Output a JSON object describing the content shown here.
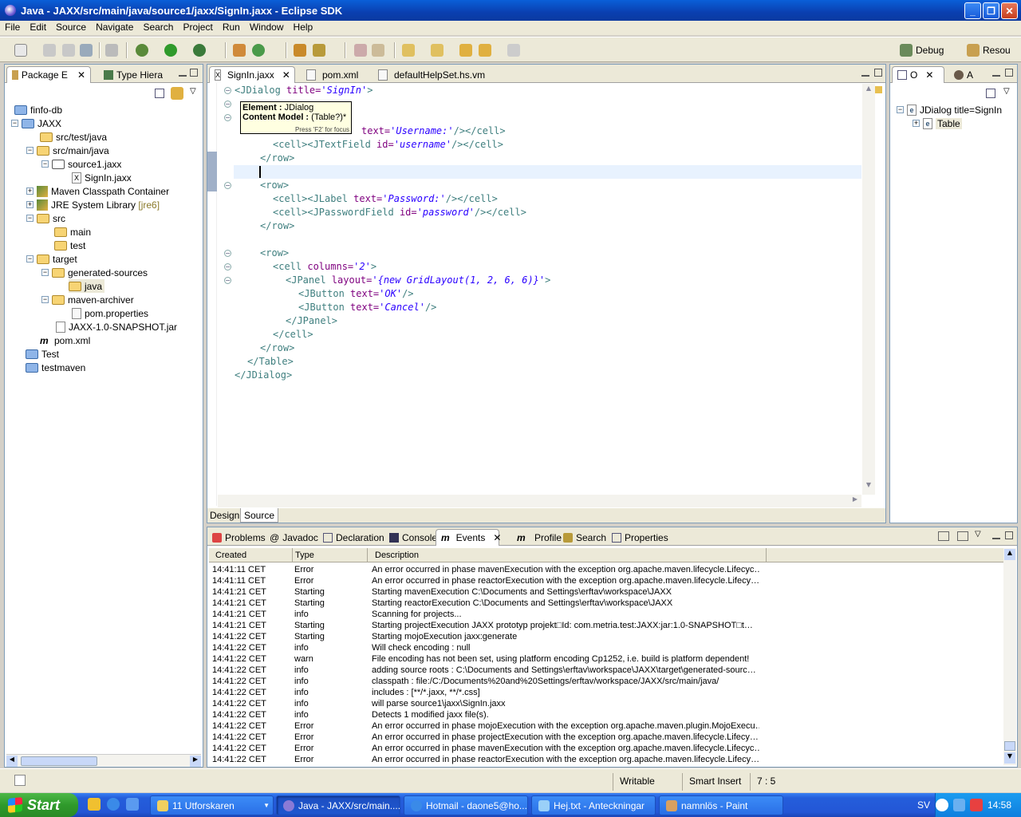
{
  "window": {
    "title": "Java - JAXX/src/main/java/source1/jaxx/SignIn.jaxx - Eclipse SDK"
  },
  "menu": [
    "File",
    "Edit",
    "Source",
    "Navigate",
    "Search",
    "Project",
    "Run",
    "Window",
    "Help"
  ],
  "perspectives": {
    "debug": "Debug",
    "resource": "Resou"
  },
  "left_view": {
    "tabs": [
      "Package E",
      "Type Hiera"
    ],
    "tree": [
      {
        "label": "finfo-db",
        "kind": "project"
      },
      {
        "label": "JAXX",
        "kind": "project"
      },
      {
        "label": "src/test/java",
        "kind": "srcfolder"
      },
      {
        "label": "src/main/java",
        "kind": "srcfolder"
      },
      {
        "label": "source1.jaxx",
        "kind": "package"
      },
      {
        "label": "SignIn.jaxx",
        "kind": "file"
      },
      {
        "label": "Maven Classpath Container",
        "kind": "lib"
      },
      {
        "label": "JRE System Library",
        "kind": "lib",
        "suffix": "[jre6]"
      },
      {
        "label": "src",
        "kind": "folder"
      },
      {
        "label": "main",
        "kind": "folder"
      },
      {
        "label": "test",
        "kind": "folder"
      },
      {
        "label": "target",
        "kind": "folder"
      },
      {
        "label": "generated-sources",
        "kind": "folder"
      },
      {
        "label": "java",
        "kind": "folder"
      },
      {
        "label": "maven-archiver",
        "kind": "folder"
      },
      {
        "label": "pom.properties",
        "kind": "file"
      },
      {
        "label": "JAXX-1.0-SNAPSHOT.jar",
        "kind": "jar"
      },
      {
        "label": "pom.xml",
        "kind": "maven"
      },
      {
        "label": "Test",
        "kind": "project"
      },
      {
        "label": "testmaven",
        "kind": "project"
      }
    ]
  },
  "editor": {
    "tabs": [
      "SignIn.jaxx",
      "pom.xml",
      "defaultHelpSet.hs.vm"
    ],
    "bottom_tabs": [
      "Design",
      "Source"
    ],
    "tooltip": {
      "element_label": "Element :",
      "element_value": "JDialog",
      "model_label": "Content Model :",
      "model_value": "(Table?)*",
      "hint": "Press 'F2' for focus"
    },
    "lines": [
      {
        "t": "<JDialog ",
        "a": "title=",
        "v": "'SignIn'",
        "e": ">"
      },
      {
        "t": "",
        "a": "",
        "v": "",
        "e": ""
      },
      {
        "t": "",
        "a": "",
        "v": "",
        "e": ""
      },
      {
        "t": "",
        "a": "text=",
        "v": "'Username:'",
        "e": "/></cell>"
      },
      {
        "t": "<cell><JTextField ",
        "a": "id=",
        "v": "'username'",
        "e": "/></cell>"
      },
      {
        "t": "</row>",
        "a": "",
        "v": "",
        "e": ""
      },
      {
        "t": "",
        "a": "",
        "v": "",
        "e": ""
      },
      {
        "t": "<row>",
        "a": "",
        "v": "",
        "e": ""
      },
      {
        "t": "<cell><JLabel ",
        "a": "text=",
        "v": "'Password:'",
        "e": "/></cell>"
      },
      {
        "t": "<cell><JPasswordField ",
        "a": "id=",
        "v": "'password'",
        "e": "/></cell>"
      },
      {
        "t": "</row>",
        "a": "",
        "v": "",
        "e": ""
      },
      {
        "t": "",
        "a": "",
        "v": "",
        "e": ""
      },
      {
        "t": "<row>",
        "a": "",
        "v": "",
        "e": ""
      },
      {
        "t": "<cell ",
        "a": "columns=",
        "v": "'2'",
        "e": ">"
      },
      {
        "t": "<JPanel ",
        "a": "layout=",
        "v": "'{new GridLayout(1, 2, 6, 6)}'",
        "e": ">"
      },
      {
        "t": "<JButton ",
        "a": "text=",
        "v": "'OK'",
        "e": "/>"
      },
      {
        "t": "<JButton ",
        "a": "text=",
        "v": "'Cancel'",
        "e": "/>"
      },
      {
        "t": "</JPanel>",
        "a": "",
        "v": "",
        "e": ""
      },
      {
        "t": "</cell>",
        "a": "",
        "v": "",
        "e": ""
      },
      {
        "t": "</row>",
        "a": "",
        "v": "",
        "e": ""
      },
      {
        "t": "</Table>",
        "a": "",
        "v": "",
        "e": ""
      },
      {
        "t": "</JDialog>",
        "a": "",
        "v": "",
        "e": ""
      }
    ]
  },
  "outline": {
    "tabs": [
      "O",
      "A"
    ],
    "items": [
      {
        "label": "JDialog title=SignIn"
      },
      {
        "label": "Table"
      }
    ]
  },
  "bottom_view": {
    "tabs": [
      "Problems",
      "Javadoc",
      "Declaration",
      "Console",
      "Events",
      "Profile",
      "Search",
      "Properties"
    ],
    "columns": [
      "Created",
      "Type",
      "Description"
    ],
    "rows": [
      [
        "14:41:11 CET",
        "Error",
        "An error occurred in phase mavenExecution with the exception org.apache.maven.lifecycle.Lifecyc…"
      ],
      [
        "14:41:11 CET",
        "Error",
        "An error occurred in phase reactorExecution with the exception org.apache.maven.lifecycle.Lifecy…"
      ],
      [
        "14:41:21 CET",
        "Starting",
        "Starting mavenExecution C:\\Documents and Settings\\erftav\\workspace\\JAXX"
      ],
      [
        "14:41:21 CET",
        "Starting",
        "Starting reactorExecution C:\\Documents and Settings\\erftav\\workspace\\JAXX"
      ],
      [
        "14:41:21 CET",
        "info",
        "Scanning for projects..."
      ],
      [
        "14:41:21 CET",
        "Starting",
        "Starting projectExecution JAXX prototyp projekt□Id: com.metria.test:JAXX:jar:1.0-SNAPSHOT□t…"
      ],
      [
        "14:41:22 CET",
        "Starting",
        "Starting mojoExecution jaxx:generate"
      ],
      [
        "14:41:22 CET",
        "info",
        "Will  check encoding : null"
      ],
      [
        "14:41:22 CET",
        "warn",
        "File encoding has not been set, using platform encoding Cp1252, i.e. build is platform dependent!"
      ],
      [
        "14:41:22 CET",
        "info",
        "adding source roots : C:\\Documents and Settings\\erftav\\workspace\\JAXX\\target\\generated-sourc…"
      ],
      [
        "14:41:22 CET",
        "info",
        "classpath : file:/C:/Documents%20and%20Settings/erftav/workspace/JAXX/src/main/java/"
      ],
      [
        "14:41:22 CET",
        "info",
        "includes : [**/*.jaxx, **/*.css]"
      ],
      [
        "14:41:22 CET",
        "info",
        "will parse source1\\jaxx\\SignIn.jaxx"
      ],
      [
        "14:41:22 CET",
        "info",
        "Detects 1 modified jaxx file(s)."
      ],
      [
        "14:41:22 CET",
        "Error",
        "An error occurred in phase mojoExecution with the exception org.apache.maven.plugin.MojoExecu…"
      ],
      [
        "14:41:22 CET",
        "Error",
        "An error occurred in phase projectExecution with the exception org.apache.maven.lifecycle.Lifecy…"
      ],
      [
        "14:41:22 CET",
        "Error",
        "An error occurred in phase mavenExecution with the exception org.apache.maven.lifecycle.Lifecyc…"
      ],
      [
        "14:41:22 CET",
        "Error",
        "An error occurred in phase reactorExecution with the exception org.apache.maven.lifecycle.Lifecy…"
      ]
    ]
  },
  "status": {
    "writable": "Writable",
    "insert_mode": "Smart Insert",
    "position": "7 : 5"
  },
  "taskbar": {
    "start": "Start",
    "tasks": [
      {
        "label": "11 Utforskaren",
        "active": false
      },
      {
        "label": "Java - JAXX/src/main....",
        "active": true
      },
      {
        "label": "Hotmail - daone5@ho...",
        "active": false
      },
      {
        "label": "Hej.txt - Anteckningar",
        "active": false
      },
      {
        "label": "namnlös - Paint",
        "active": false
      }
    ],
    "language": "SV",
    "clock": "14:58"
  }
}
